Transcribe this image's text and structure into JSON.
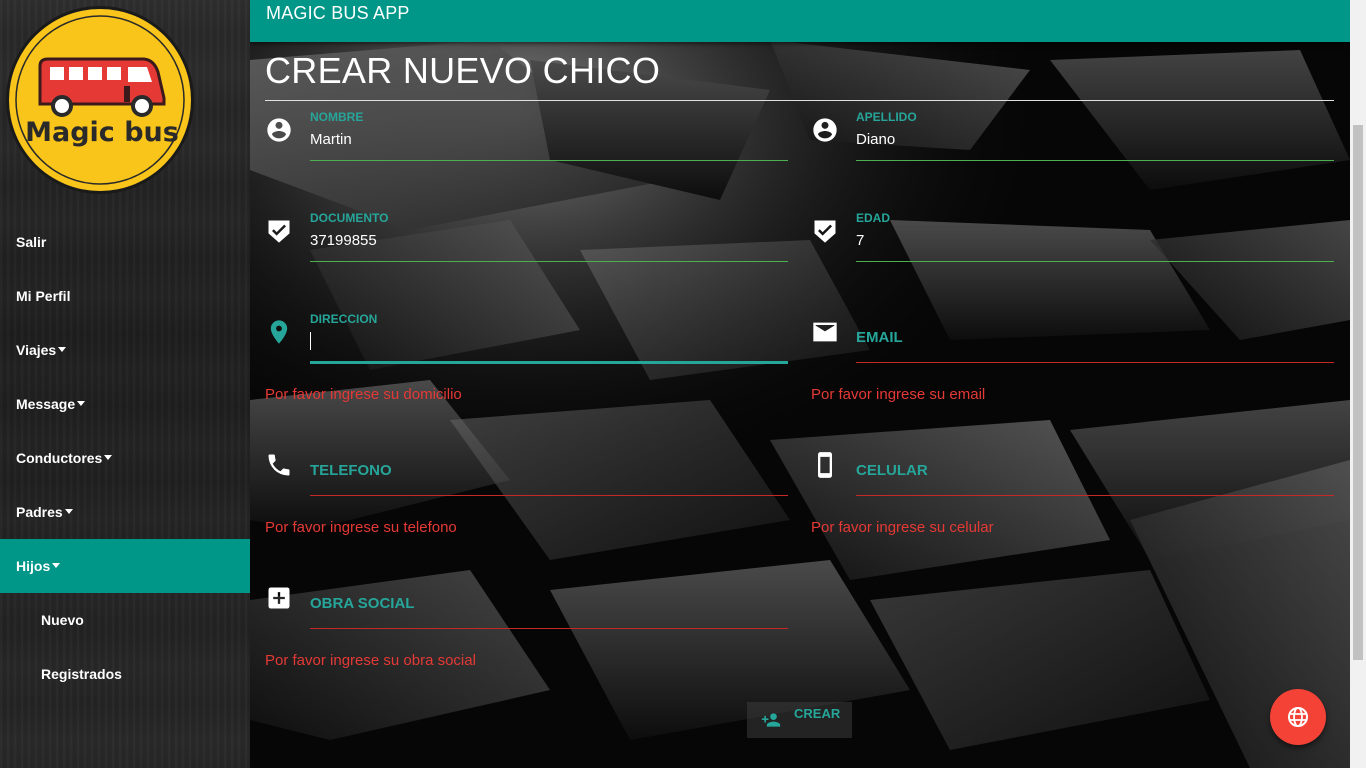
{
  "logo": {
    "text": "Magic bus",
    "bg_color": "#f9c51a",
    "bus_color": "#e53935"
  },
  "sidebar": {
    "items": [
      {
        "label": "Salir",
        "caret": false
      },
      {
        "label": "Mi Perfil",
        "caret": false
      },
      {
        "label": "Viajes",
        "caret": true
      },
      {
        "label": "Message",
        "caret": true
      },
      {
        "label": "Conductores",
        "caret": true
      },
      {
        "label": "Padres",
        "caret": true
      },
      {
        "label": "Hijos",
        "caret": true,
        "active": true
      },
      {
        "label": "Nuevo",
        "sub": true
      },
      {
        "label": "Registrados",
        "sub": true
      }
    ]
  },
  "header": {
    "app_title": "MAGIC BUS APP"
  },
  "form": {
    "title": "CREAR NUEVO CHICO",
    "fields": {
      "nombre": {
        "label": "NOMBRE",
        "value": "Martin",
        "icon": "account-circle-icon"
      },
      "apellido": {
        "label": "APELLIDO",
        "value": "Diano",
        "icon": "account-circle-icon"
      },
      "documento": {
        "label": "DOCUMENTO",
        "value": "37199855",
        "icon": "verified-badge-icon"
      },
      "edad": {
        "label": "EDAD",
        "value": "7",
        "icon": "verified-badge-icon"
      },
      "direccion": {
        "label": "DIRECCION",
        "value": "",
        "error": "Por favor ingrese su domicilio",
        "icon": "location-pin-icon",
        "focused": true
      },
      "email": {
        "label": "EMAIL",
        "value": "",
        "error": "Por favor ingrese su email",
        "icon": "mail-icon"
      },
      "telefono": {
        "label": "TELEFONO",
        "value": "",
        "error": "Por favor ingrese su telefono",
        "icon": "phone-icon"
      },
      "celular": {
        "label": "CELULAR",
        "value": "",
        "error": "Por favor ingrese su celular",
        "icon": "smartphone-icon"
      },
      "obra_social": {
        "label": "OBRA SOCIAL",
        "value": "",
        "error": "Por favor ingrese su obra social",
        "icon": "medical-plus-icon"
      }
    },
    "submit_label": "CREAR"
  },
  "colors": {
    "accent": "#009688",
    "accent_light": "#26a69a",
    "error": "#e53935",
    "fab": "#f44336"
  },
  "fab": {
    "icon": "globe-icon"
  }
}
